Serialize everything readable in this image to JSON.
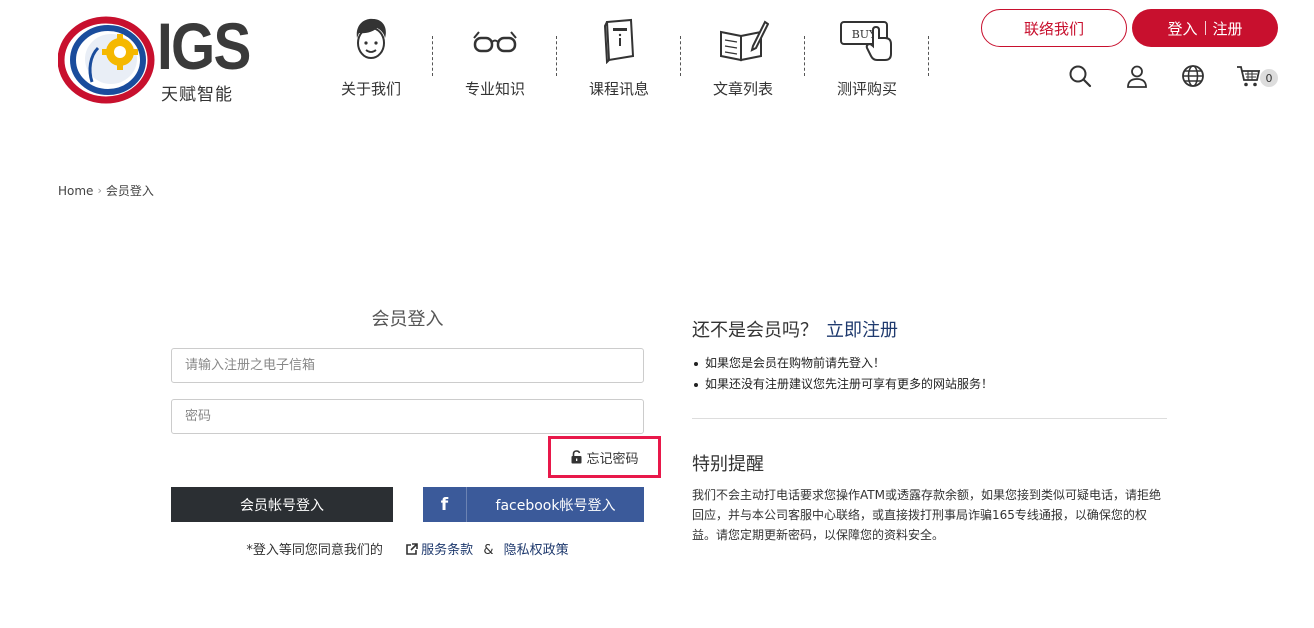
{
  "brand": {
    "logo_text": "IGS",
    "logo_cn": "天赋智能"
  },
  "nav": [
    {
      "label": "关于我们",
      "icon": "boy-face-icon"
    },
    {
      "label": "专业知识",
      "icon": "glasses-icon"
    },
    {
      "label": "课程讯息",
      "icon": "book-icon"
    },
    {
      "label": "文章列表",
      "icon": "open-book-pen-icon"
    },
    {
      "label": "测评购买",
      "icon": "buy-button-icon",
      "icon_text": "BUY"
    }
  ],
  "header": {
    "contact_label": "联络我们",
    "login_label": "登入",
    "register_label": "注册",
    "cart_count": "0"
  },
  "breadcrumb": {
    "home": "Home",
    "current": "会员登入"
  },
  "login": {
    "title": "会员登入",
    "email_placeholder": "请输入注册之电子信箱",
    "password_placeholder": "密码",
    "forgot_label": "忘记密码",
    "member_button": "会员帐号登入",
    "fb_icon": "f",
    "fb_button": "facebook帐号登入",
    "terms_prefix": "*登入等同您同意我们的",
    "terms_link": "服务条款",
    "terms_amp": "&",
    "privacy_link": "隐私权政策"
  },
  "register": {
    "title": "还不是会员吗？",
    "link": "立即注册",
    "items": [
      "如果您是会员在购物前请先登入！",
      "如果还没有注册建议您先注册可享有更多的网站服务！"
    ]
  },
  "notice": {
    "title": "特别提醒",
    "text": "我们不会主动打电话要求您操作ATM或透露存款余额，如果您接到类似可疑电话，请拒绝回应，并与本公司客服中心联络，或直接拨打刑事局诈骗165专线通报，以确保您的权益。请您定期更新密码，以保障您的资料安全。"
  },
  "colors": {
    "brand_red": "#c8102e",
    "highlight": "#e8184a",
    "facebook": "#3b5a9a",
    "dark_button": "#2b2f33",
    "link": "#1f3a6e"
  }
}
